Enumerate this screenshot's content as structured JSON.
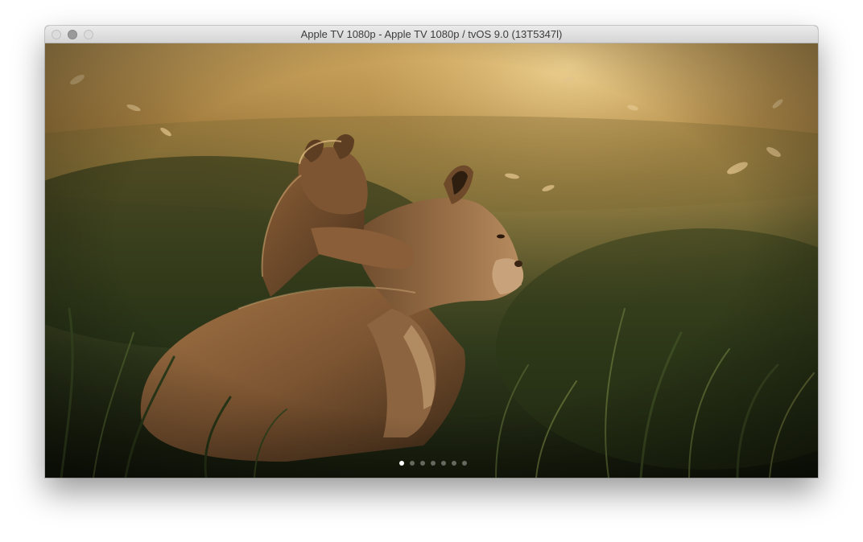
{
  "window": {
    "title": "Apple TV 1080p - Apple TV 1080p / tvOS 9.0 (13T5347l)"
  },
  "screen": {
    "content": "screensaver photo of a lioness and cub in tall grass at sunset",
    "page_indicator": {
      "total": 7,
      "current": 1
    }
  },
  "colors": {
    "titlebar_top": "#ebebeb",
    "titlebar_bottom": "#d5d5d5",
    "grass_dark": "#2a3a1a",
    "sky_glow": "#c9a45a",
    "lion_fur": "#8a6038"
  }
}
